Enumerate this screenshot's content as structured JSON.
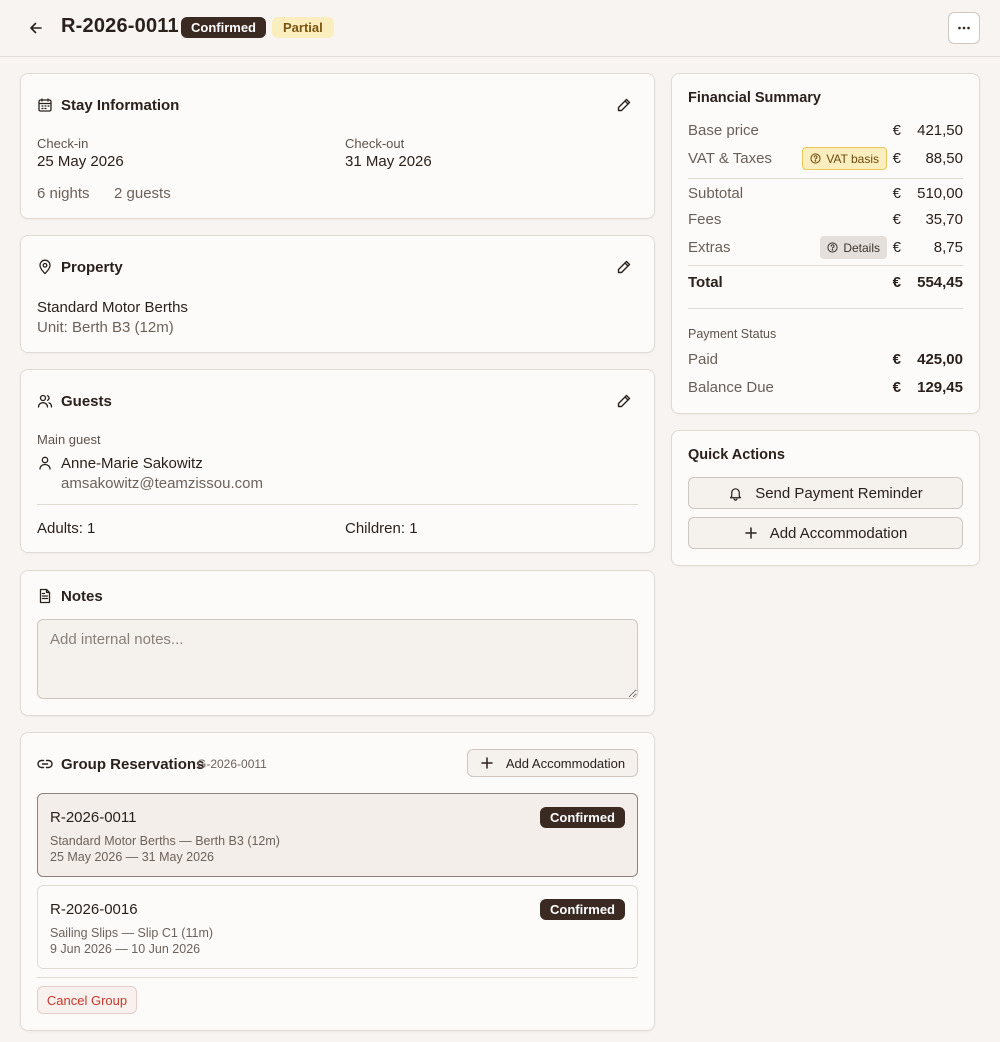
{
  "header": {
    "reservation_id": "R-2026-0011",
    "status_badge": "Confirmed",
    "payment_badge": "Partial"
  },
  "stay": {
    "title": "Stay Information",
    "checkin_label": "Check-in",
    "checkin_value": "25 May 2026",
    "checkout_label": "Check-out",
    "checkout_value": "31 May 2026",
    "nights": "6 nights",
    "guests": "2 guests"
  },
  "property": {
    "title": "Property",
    "name": "Standard Motor Berths",
    "unit": "Unit: Berth B3 (12m)"
  },
  "guests": {
    "title": "Guests",
    "main_label": "Main guest",
    "main_name": "Anne-Marie Sakowitz",
    "main_email": "amsakowitz@teamzissou.com",
    "adults_label": "Adults:",
    "adults_value": "1",
    "children_label": "Children:",
    "children_value": "1"
  },
  "notes": {
    "title": "Notes",
    "placeholder": "Add internal notes..."
  },
  "group": {
    "title": "Group Reservations",
    "group_id": "G-2026-0011",
    "add_label": "Add Accommodation",
    "items": [
      {
        "id": "R-2026-0011",
        "status": "Confirmed",
        "desc": "Standard Motor Berths — Berth B3 (12m)",
        "dates": "25 May 2026 — 31 May 2026"
      },
      {
        "id": "R-2026-0016",
        "status": "Confirmed",
        "desc": "Sailing Slips — Slip C1 (11m)",
        "dates": "9 Jun 2026 — 10 Jun 2026"
      }
    ],
    "cancel_label": "Cancel Group"
  },
  "financial": {
    "title": "Financial Summary",
    "currency": "€",
    "base_label": "Base price",
    "base_value": "421,50",
    "vat_label": "VAT & Taxes",
    "vat_pill": "VAT basis",
    "vat_value": "88,50",
    "subtotal_label": "Subtotal",
    "subtotal_value": "510,00",
    "fees_label": "Fees",
    "fees_value": "35,70",
    "extras_label": "Extras",
    "extras_pill": "Details",
    "extras_value": "8,75",
    "total_label": "Total",
    "total_value": "554,45",
    "payment_status_label": "Payment Status",
    "paid_label": "Paid",
    "paid_value": "425,00",
    "balance_label": "Balance Due",
    "balance_value": "129,45"
  },
  "quick_actions": {
    "title": "Quick Actions",
    "reminder_label": "Send Payment Reminder",
    "add_label": "Add Accommodation"
  },
  "colors": {
    "background": "#f7f4f1",
    "badge_dark": "#3a2a22",
    "badge_partial": "#fbeebe",
    "danger": "#c7382c"
  }
}
